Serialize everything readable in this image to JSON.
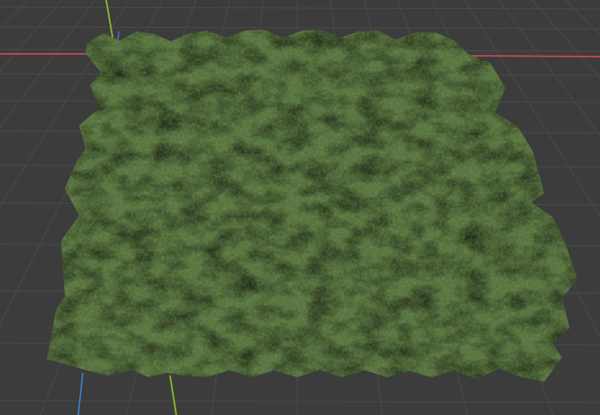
{
  "viewport": {
    "background": "#3c3c3c",
    "grid_color": "#4a4a4a",
    "axis_x_color": "#d94a5a",
    "axis_y_color": "#8ab82a",
    "axis_z_color": "#3a86d4"
  },
  "terrain": {
    "shape": "hex-tile-mesh",
    "base_color": "#55703d",
    "light_color": "#6a8a4a",
    "dark_color": "#2d3f22"
  }
}
